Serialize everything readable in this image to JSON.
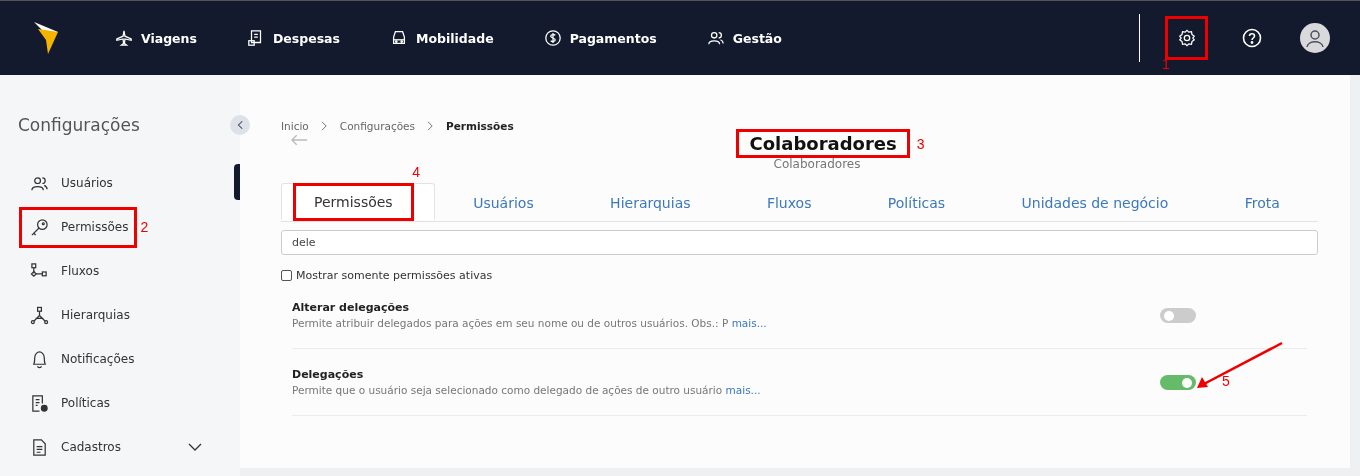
{
  "nav": {
    "items": [
      {
        "label": "Viagens"
      },
      {
        "label": "Despesas"
      },
      {
        "label": "Mobilidade"
      },
      {
        "label": "Pagamentos"
      },
      {
        "label": "Gestão"
      }
    ],
    "actions": [
      {
        "kind": "settings",
        "callout": "1"
      },
      {
        "kind": "help"
      },
      {
        "kind": "avatar"
      }
    ]
  },
  "sidebar": {
    "title": "Configurações",
    "items": [
      {
        "label": "Usuários"
      },
      {
        "label": "Permissões",
        "callout": "2"
      },
      {
        "label": "Fluxos"
      },
      {
        "label": "Hierarquias"
      },
      {
        "label": "Notificações"
      },
      {
        "label": "Políticas"
      },
      {
        "label": "Cadastros",
        "expanded": false
      }
    ]
  },
  "breadcrumb": [
    "Inicio",
    "Configurações",
    "Permissões"
  ],
  "page": {
    "title": "Colaboradores",
    "title_callout": "3",
    "subtitle": "Colaboradores"
  },
  "tabs": [
    {
      "label": "Permissões",
      "selected": true,
      "callout": "4"
    },
    {
      "label": "Usuários",
      "selected": false
    },
    {
      "label": "Hierarquias",
      "selected": false
    },
    {
      "label": "Fluxos",
      "selected": false
    },
    {
      "label": "Políticas",
      "selected": false
    },
    {
      "label": "Unidades de negócio",
      "selected": false
    },
    {
      "label": "Frota",
      "selected": false
    }
  ],
  "search": {
    "value": "dele"
  },
  "filter": {
    "label": "Mostrar somente permissões ativas",
    "checked": false
  },
  "permissions": [
    {
      "title": "Alterar delegações",
      "description": "Permite atribuir delegados para ações em seu nome ou de outros usuários. Obs.: P",
      "link": "mais...",
      "on": false
    },
    {
      "title": "Delegações",
      "description": "Permite que o usuário seja selecionado como delegado de ações de outro usuário",
      "link": "mais...",
      "on": true,
      "callout": "5"
    }
  ]
}
